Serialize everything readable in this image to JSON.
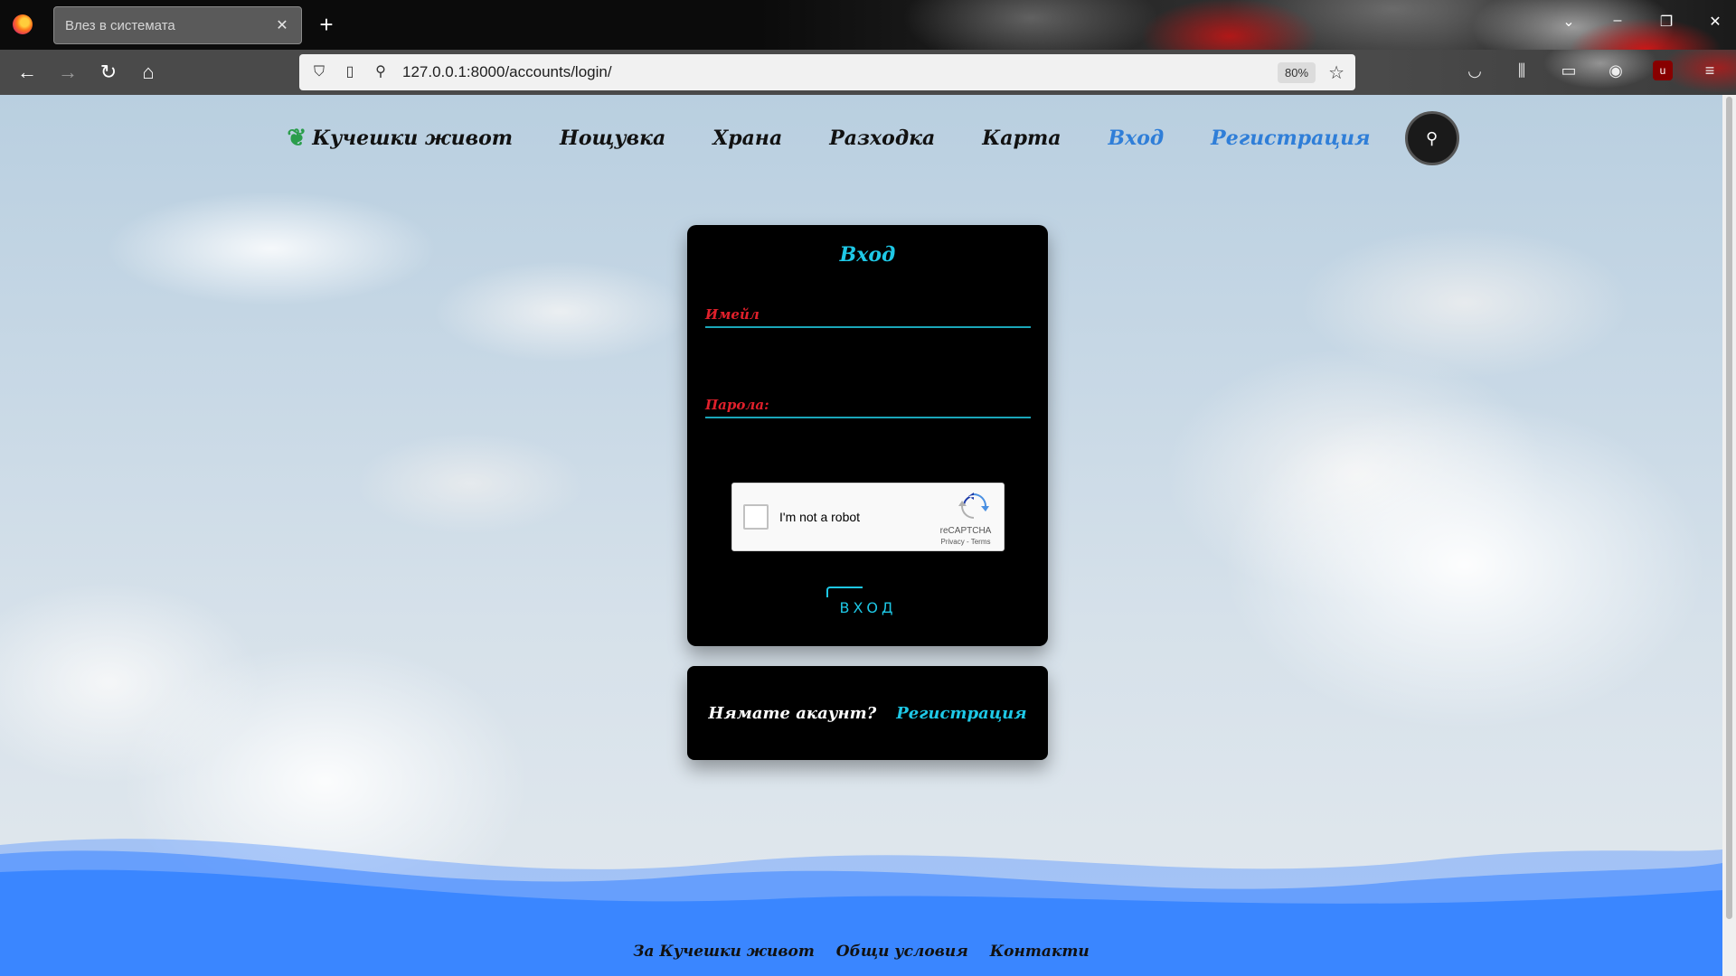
{
  "browser": {
    "tab_title": "Влез в системата",
    "url": "127.0.0.1:8000/accounts/login/",
    "zoom": "80%"
  },
  "site_nav": {
    "brand": "Кучешки живот",
    "items": [
      {
        "label": "Нощувка",
        "active": false
      },
      {
        "label": "Храна",
        "active": false
      },
      {
        "label": "Разходка",
        "active": false
      },
      {
        "label": "Карта",
        "active": false
      },
      {
        "label": "Вход",
        "active": true
      },
      {
        "label": "Регистрация",
        "active": true
      }
    ]
  },
  "login": {
    "title": "Вход",
    "email_label": "Имейл",
    "password_label": "Парола:",
    "submit_label": "ВХОД"
  },
  "recaptcha": {
    "label": "I'm not a robot",
    "brand": "reCAPTCHA",
    "links": "Privacy - Terms"
  },
  "signup": {
    "text": "Нямате акаунт?",
    "link": "Регистрация"
  },
  "footer": {
    "links": [
      "За Кучешки живот",
      "Общи условия",
      "Контакти"
    ]
  },
  "colors": {
    "accent_cyan": "#1ec8e6",
    "label_red": "#e0202b",
    "active_nav_blue": "#2f7ed8",
    "wave_blue": "#3a86ff"
  }
}
